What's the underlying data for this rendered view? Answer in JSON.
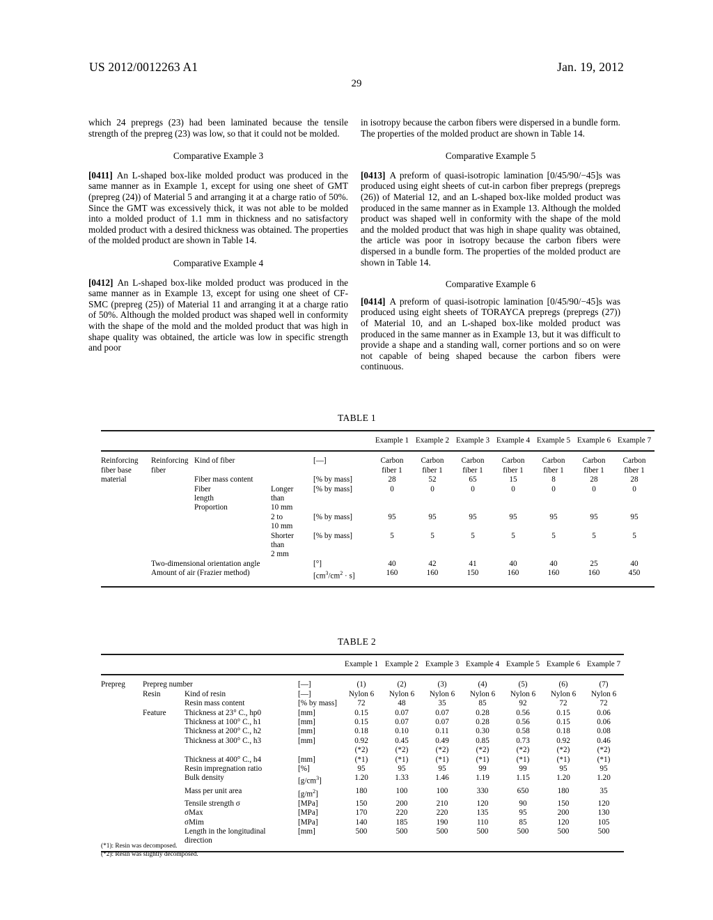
{
  "header": {
    "publication_number": "US 2012/0012263 A1",
    "date": "Jan. 19, 2012",
    "page_number": "29"
  },
  "left_column": {
    "continued_paragraph": "which 24 prepregs (23) had been laminated because the tensile strength of the prepreg (23) was low, so that it could not be molded.",
    "heading_1": "Comparative Example 3",
    "para_0411_num": "[0411]",
    "para_0411_text": "An L-shaped box-like molded product was produced in the same manner as in Example 1, except for using one sheet of GMT (prepreg (24)) of Material 5 and arranging it at a charge ratio of 50%. Since the GMT was excessively thick, it was not able to be molded into a molded product of 1.1 mm in thickness and no satisfactory molded product with a desired thickness was obtained. The properties of the molded product are shown in Table 14.",
    "heading_2": "Comparative Example 4",
    "para_0412_num": "[0412]",
    "para_0412_text": "An L-shaped box-like molded product was produced in the same manner as in Example 13, except for using one sheet of CF-SMC (prepreg (25)) of Material 11 and arranging it at a charge ratio of 50%. Although the molded product was shaped well in conformity with the shape of the mold and the molded product that was high in shape quality was obtained, the article was low in specific strength and poor"
  },
  "right_column": {
    "continued_paragraph": "in isotropy because the carbon fibers were dispersed in a bundle form. The properties of the molded product are shown in Table 14.",
    "heading_1": "Comparative Example 5",
    "para_0413_num": "[0413]",
    "para_0413_text": "A preform of quasi-isotropic lamination [0/45/90/−45]s was produced using eight sheets of cut-in carbon fiber prepregs (prepregs (26)) of Material 12, and an L-shaped box-like molded product was produced in the same manner as in Example 13. Although the molded product was shaped well in conformity with the shape of the mold and the molded product that was high in shape quality was obtained, the article was poor in isotropy because the carbon fibers were dispersed in a bundle form. The properties of the molded product are shown in Table 14.",
    "heading_2": "Comparative Example 6",
    "para_0414_num": "[0414]",
    "para_0414_text": "A preform of quasi-isotropic lamination [0/45/90/−45]s was produced using eight sheets of TORAYCA prepregs (prepregs (27)) of Material 10, and an L-shaped box-like molded product was produced in the same manner as in Example 13, but it was difficult to provide a shape and a standing wall, corner portions and so on were not capable of being shaped because the carbon fibers were continuous."
  },
  "table1": {
    "title": "TABLE 1",
    "column_headers": [
      "Example 1",
      "Example 2",
      "Example 3",
      "Example 4",
      "Example 5",
      "Example 6",
      "Example 7"
    ],
    "rows": [
      {
        "c1": "Reinforcing",
        "c2": "Reinforcing",
        "c3": "Kind of fiber",
        "c4": "",
        "unit": "[—]",
        "values": [
          "Carbon",
          "Carbon",
          "Carbon",
          "Carbon",
          "Carbon",
          "Carbon",
          "Carbon"
        ]
      },
      {
        "c1": "fiber base",
        "c2": "fiber",
        "c3": "",
        "c4": "",
        "unit": "",
        "values": [
          "fiber 1",
          "fiber 1",
          "fiber 1",
          "fiber 1",
          "fiber 1",
          "fiber 1",
          "fiber 1"
        ]
      },
      {
        "c1": "material",
        "c2": "",
        "c3": "Fiber mass content",
        "c4": "",
        "unit": "[% by mass]",
        "values": [
          "28",
          "52",
          "65",
          "15",
          "8",
          "28",
          "28"
        ]
      },
      {
        "c1": "",
        "c2": "",
        "c3": "Fiber",
        "c4": "Longer",
        "unit": "[% by mass]",
        "values": [
          "0",
          "0",
          "0",
          "0",
          "0",
          "0",
          "0"
        ]
      },
      {
        "c1": "",
        "c2": "",
        "c3": "length",
        "c4": "than",
        "unit": "",
        "values": [
          "",
          "",
          "",
          "",
          "",
          "",
          ""
        ]
      },
      {
        "c1": "",
        "c2": "",
        "c3": "Proportion",
        "c4": "10 mm",
        "unit": "",
        "values": [
          "",
          "",
          "",
          "",
          "",
          "",
          ""
        ]
      },
      {
        "c1": "",
        "c2": "",
        "c3": "",
        "c4": "2 to",
        "unit": "[% by mass]",
        "values": [
          "95",
          "95",
          "95",
          "95",
          "95",
          "95",
          "95"
        ]
      },
      {
        "c1": "",
        "c2": "",
        "c3": "",
        "c4": "10 mm",
        "unit": "",
        "values": [
          "",
          "",
          "",
          "",
          "",
          "",
          ""
        ]
      },
      {
        "c1": "",
        "c2": "",
        "c3": "",
        "c4": "Shorter",
        "unit": "[% by mass]",
        "values": [
          "5",
          "5",
          "5",
          "5",
          "5",
          "5",
          "5"
        ]
      },
      {
        "c1": "",
        "c2": "",
        "c3": "",
        "c4": "than",
        "unit": "",
        "values": [
          "",
          "",
          "",
          "",
          "",
          "",
          ""
        ]
      },
      {
        "c1": "",
        "c2": "",
        "c3": "",
        "c4": "2 mm",
        "unit": "",
        "values": [
          "",
          "",
          "",
          "",
          "",
          "",
          ""
        ]
      },
      {
        "c1": "",
        "c2": "Two-dimensional orientation angle",
        "c2_span": true,
        "c3": "",
        "c4": "",
        "unit": "[°]",
        "values": [
          "40",
          "42",
          "41",
          "40",
          "40",
          "25",
          "40"
        ]
      },
      {
        "c1": "",
        "c2": "Amount of air (Frazier method)",
        "c2_span": true,
        "c3": "",
        "c4": "",
        "unit": "[cm3/cm2 · s]",
        "values": [
          "160",
          "160",
          "150",
          "160",
          "160",
          "160",
          "450"
        ]
      }
    ]
  },
  "table2": {
    "title": "TABLE 2",
    "column_headers": [
      "Example 1",
      "Example 2",
      "Example 3",
      "Example 4",
      "Example 5",
      "Example 6",
      "Example 7"
    ],
    "rows": [
      {
        "c1": "Prepreg",
        "c2": "Prepreg number",
        "c2_span": true,
        "c3": "",
        "unit": "[—]",
        "values": [
          "(1)",
          "(2)",
          "(3)",
          "(4)",
          "(5)",
          "(6)",
          "(7)"
        ]
      },
      {
        "c1": "",
        "c2": "Resin",
        "c3": "Kind of resin",
        "unit": "[—]",
        "values": [
          "Nylon 6",
          "Nylon 6",
          "Nylon 6",
          "Nylon 6",
          "Nylon 6",
          "Nylon 6",
          "Nylon 6"
        ]
      },
      {
        "c1": "",
        "c2": "",
        "c3": "Resin mass content",
        "unit": "[% by mass]",
        "values": [
          "72",
          "48",
          "35",
          "85",
          "92",
          "72",
          "72"
        ]
      },
      {
        "c1": "",
        "c2": "Feature",
        "c3": "Thickness at 23° C., hp0",
        "unit": "[mm]",
        "values": [
          "0.15",
          "0.07",
          "0.07",
          "0.28",
          "0.56",
          "0.15",
          "0.06"
        ]
      },
      {
        "c1": "",
        "c2": "",
        "c3": "Thickness at 100° C., h1",
        "unit": "[mm]",
        "values": [
          "0.15",
          "0.07",
          "0.07",
          "0.28",
          "0.56",
          "0.15",
          "0.06"
        ]
      },
      {
        "c1": "",
        "c2": "",
        "c3": "Thickness at 200° C., h2",
        "unit": "[mm]",
        "values": [
          "0.18",
          "0.10",
          "0.11",
          "0.30",
          "0.58",
          "0.18",
          "0.08"
        ]
      },
      {
        "c1": "",
        "c2": "",
        "c3": "Thickness at 300° C., h3",
        "unit": "[mm]",
        "values": [
          "0.92",
          "0.45",
          "0.49",
          "0.85",
          "0.73",
          "0.92",
          "0.46"
        ]
      },
      {
        "c1": "",
        "c2": "",
        "c3": "",
        "unit": "",
        "values": [
          "(*2)",
          "(*2)",
          "(*2)",
          "(*2)",
          "(*2)",
          "(*2)",
          "(*2)"
        ]
      },
      {
        "c1": "",
        "c2": "",
        "c3": "Thickness at 400° C., h4",
        "unit": "[mm]",
        "values": [
          "(*1)",
          "(*1)",
          "(*1)",
          "(*1)",
          "(*1)",
          "(*1)",
          "(*1)"
        ]
      },
      {
        "c1": "",
        "c2": "",
        "c3": "Resin impregnation ratio",
        "unit": "[%]",
        "values": [
          "95",
          "95",
          "95",
          "99",
          "99",
          "95",
          "95"
        ]
      },
      {
        "c1": "",
        "c2": "",
        "c3": "Bulk density",
        "unit": "[g/cm3]",
        "values": [
          "1.20",
          "1.33",
          "1.46",
          "1.19",
          "1.15",
          "1.20",
          "1.20"
        ]
      },
      {
        "c1": "",
        "c2": "",
        "c3": "Mass per unit area",
        "unit": "[g/m2]",
        "values": [
          "180",
          "100",
          "100",
          "330",
          "650",
          "180",
          "35"
        ]
      },
      {
        "c1": "",
        "c2": "",
        "c3": "Tensile strength σ",
        "unit": "[MPa]",
        "values": [
          "150",
          "200",
          "210",
          "120",
          "90",
          "150",
          "120"
        ]
      },
      {
        "c1": "",
        "c2": "",
        "c3": "σMax",
        "unit": "[MPa]",
        "values": [
          "170",
          "220",
          "220",
          "135",
          "95",
          "200",
          "130"
        ]
      },
      {
        "c1": "",
        "c2": "",
        "c3": "σMim",
        "unit": "[MPa]",
        "values": [
          "140",
          "185",
          "190",
          "110",
          "85",
          "120",
          "105"
        ]
      },
      {
        "c1": "",
        "c2": "",
        "c3": "Length in the longitudinal",
        "unit": "[mm]",
        "values": [
          "500",
          "500",
          "500",
          "500",
          "500",
          "500",
          "500"
        ]
      },
      {
        "c1": "",
        "c2": "",
        "c3": "direction",
        "unit": "",
        "values": [
          "",
          "",
          "",
          "",
          "",
          "",
          ""
        ]
      }
    ]
  },
  "footnotes": {
    "note1": "(*1): Resin was decomposed.",
    "note2": "(*2): Resin was slightly decomposed."
  }
}
